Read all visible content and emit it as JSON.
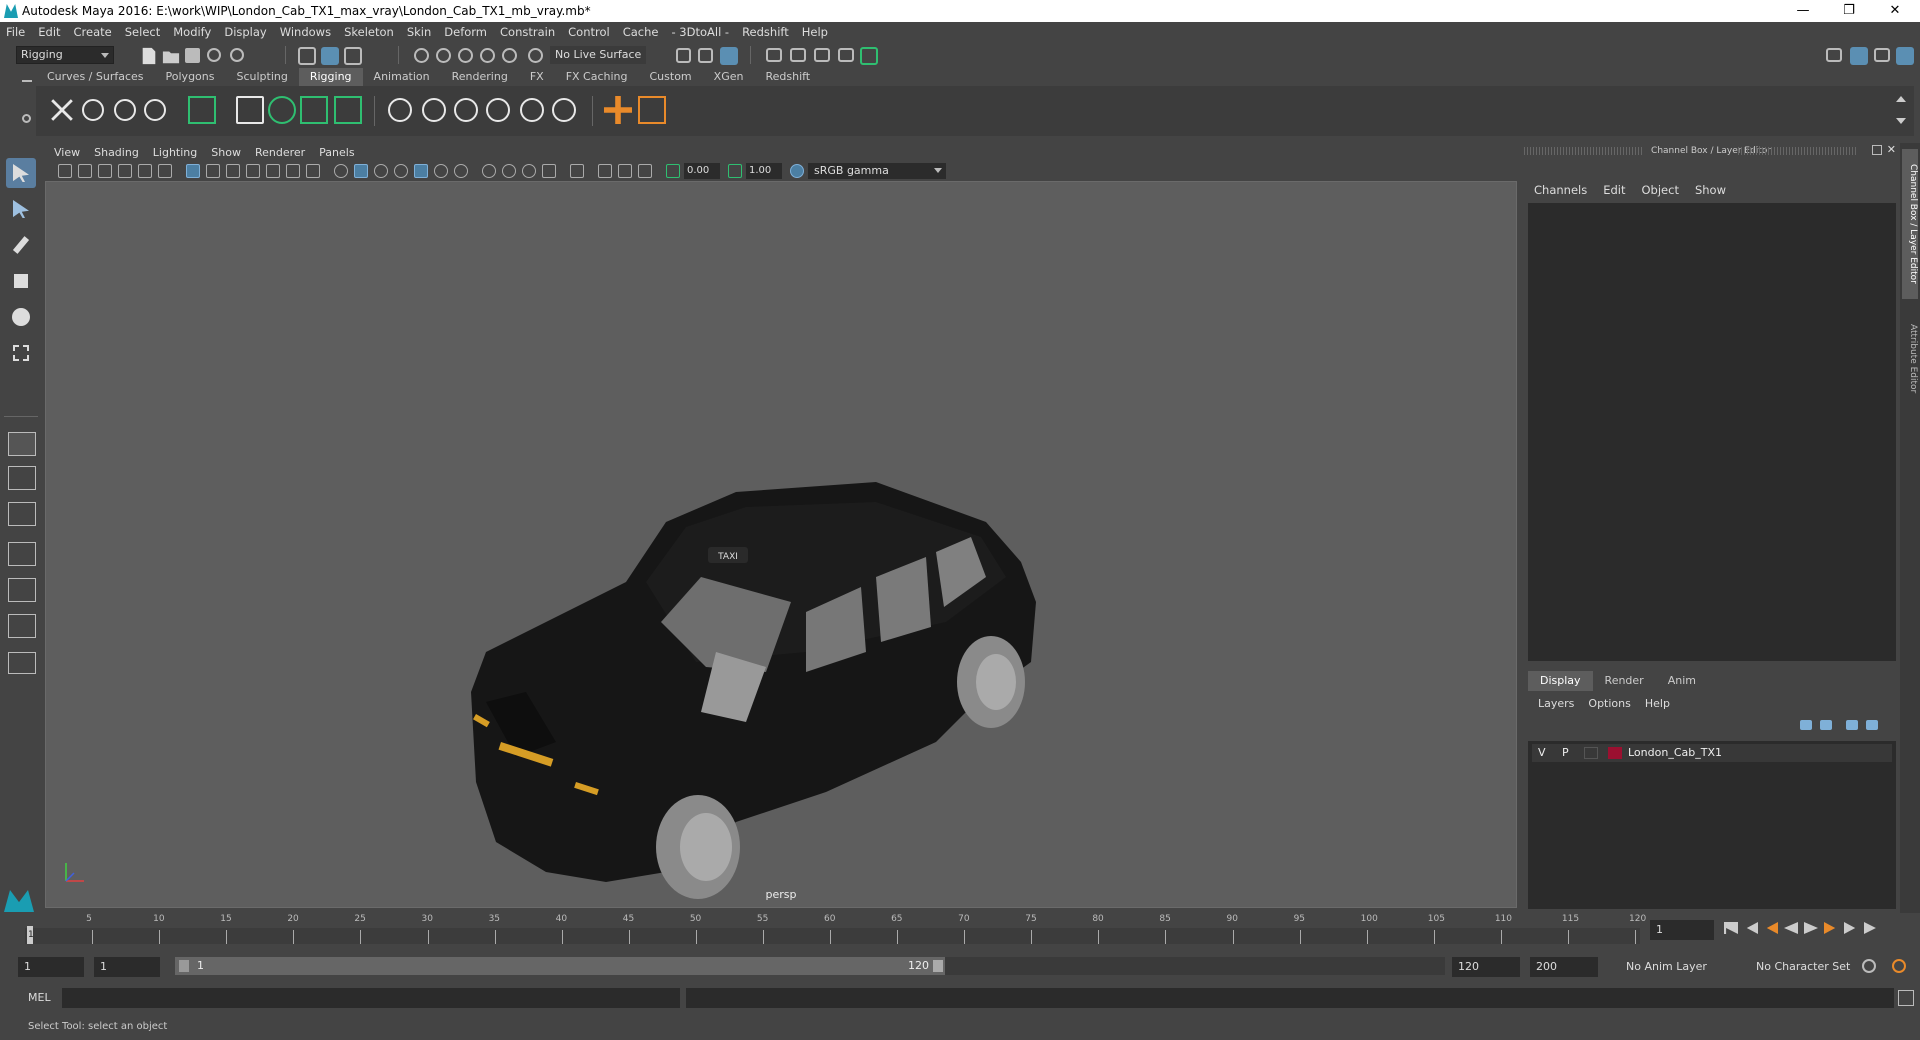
{
  "window": {
    "title": "Autodesk Maya 2016: E:\\work\\WIP\\London_Cab_TX1_max_vray\\London_Cab_TX1_mb_vray.mb*",
    "min": "—",
    "max": "❐",
    "close": "✕"
  },
  "menubar": [
    "File",
    "Edit",
    "Create",
    "Select",
    "Modify",
    "Display",
    "Windows",
    "Skeleton",
    "Skin",
    "Deform",
    "Constrain",
    "Control",
    "Cache",
    "- 3DtoAll -",
    "Redshift",
    "Help"
  ],
  "statusline": {
    "mode": "Rigging",
    "live_surface": "No Live Surface"
  },
  "shelf": {
    "tabs": [
      "Curves / Surfaces",
      "Polygons",
      "Sculpting",
      "Rigging",
      "Animation",
      "Rendering",
      "FX",
      "FX Caching",
      "Custom",
      "XGen",
      "Redshift"
    ],
    "active_tab": "Rigging"
  },
  "viewport": {
    "menu": [
      "View",
      "Shading",
      "Lighting",
      "Show",
      "Renderer",
      "Panels"
    ],
    "exposure": "0.00",
    "gamma": "1.00",
    "color_space": "sRGB gamma",
    "camera_label": "persp",
    "model_roof_sign": "TAXI"
  },
  "channel_box": {
    "title": "Channel Box / Layer Editor",
    "menu": [
      "Channels",
      "Edit",
      "Object",
      "Show"
    ]
  },
  "layer_editor": {
    "tabs": [
      "Display",
      "Render",
      "Anim"
    ],
    "active_tab": "Display",
    "menu": [
      "Layers",
      "Options",
      "Help"
    ],
    "layers": [
      {
        "v": "V",
        "p": "P",
        "name": "London_Cab_TX1",
        "color": "#9b1030"
      }
    ]
  },
  "side_tabs": [
    "Channel Box / Layer Editor",
    "Attribute Editor"
  ],
  "timeline": {
    "ticks": [
      5,
      10,
      15,
      20,
      25,
      30,
      35,
      40,
      45,
      50,
      55,
      60,
      65,
      70,
      75,
      80,
      85,
      90,
      95,
      100,
      105,
      110,
      115,
      120
    ],
    "current_frame_marker": "1",
    "current_frame_field": "1"
  },
  "range": {
    "start_time": "1",
    "playback_start": "1",
    "bar_start": "1",
    "bar_end": "120",
    "playback_end": "120",
    "end_time": "200",
    "anim_layer": "No Anim Layer",
    "character_set": "No Character Set"
  },
  "command_line": {
    "label": "MEL"
  },
  "help_line": "Select Tool: select an object"
}
